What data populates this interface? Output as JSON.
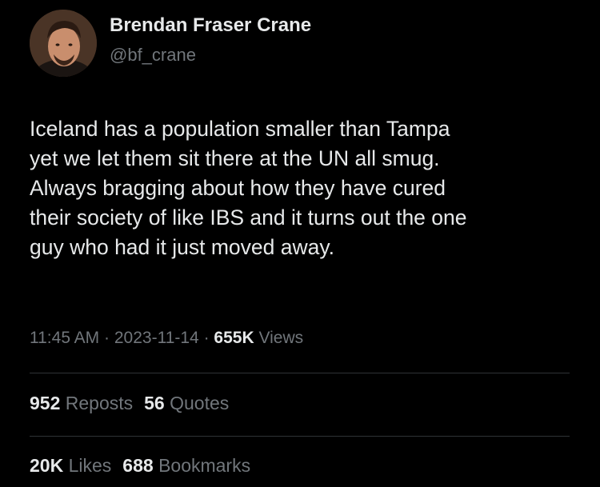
{
  "author": {
    "display_name": "Brendan Fraser Crane",
    "handle": "@bf_crane"
  },
  "tweet": {
    "lines": [
      "Iceland has a population smaller than Tampa",
      "yet we let them sit there at the UN all smug.",
      "Always bragging about how they have cured",
      "their society of like IBS and it turns out the one",
      "guy who had it just moved away."
    ]
  },
  "meta": {
    "time": "11:45 AM",
    "separator": "·",
    "date": "2023-11-14",
    "views_count": "655K",
    "views_label": "Views"
  },
  "stats": {
    "reposts_count": "952",
    "reposts_label": "Reposts",
    "quotes_count": "56",
    "quotes_label": "Quotes",
    "likes_count": "20K",
    "likes_label": "Likes",
    "bookmarks_count": "688",
    "bookmarks_label": "Bookmarks"
  },
  "colors": {
    "background": "#000000",
    "primary_text": "#e7e9ea",
    "secondary_text": "#71767b",
    "divider": "#2f3336"
  }
}
